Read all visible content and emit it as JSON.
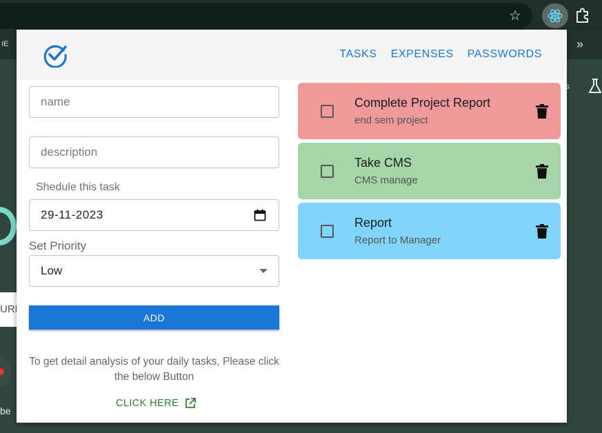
{
  "browser": {
    "bookmark_left_text": "IE",
    "bookmarks_overflow_icon": "chevron-double-right-icon",
    "star_icon": "star-icon",
    "background_url_text": "URL",
    "background_text": "be",
    "background_s_text": "s"
  },
  "nav": {
    "logo_icon": "check-circle-icon",
    "items": [
      "TASKS",
      "EXPENSES",
      "PASSWORDS"
    ]
  },
  "form": {
    "name_placeholder": "name",
    "description_placeholder": "description",
    "schedule_label": "Shedule this task",
    "date_value": "29-11-2023",
    "priority_label": "Set Priority",
    "priority_value": "Low",
    "add_label": "ADD"
  },
  "info": {
    "text": "To get detail analysis of your daily tasks, Please click the below Button",
    "link_label": "CLICK HERE"
  },
  "tasks": [
    {
      "title": "Complete Project Report",
      "description": "end sem project",
      "color": "#ef9a9a"
    },
    {
      "title": "Take CMS",
      "description": "CMS manage",
      "color": "#a5d6a7"
    },
    {
      "title": "Report",
      "description": "Report to Manager",
      "color": "#81d4fa"
    }
  ],
  "colors": {
    "accent": "#1976d2",
    "link_green": "#2e7d32"
  }
}
